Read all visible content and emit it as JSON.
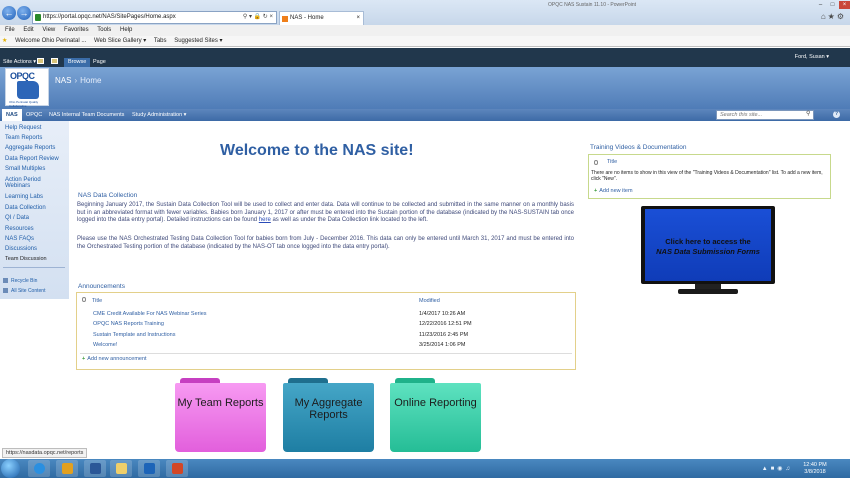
{
  "browser": {
    "url": "https://portal.opqc.net/NAS/SitePages/Home.aspx",
    "tab_title": "NAS - Home",
    "window_title": "OPQC NAS Sustain 11.10 - PowerPoint",
    "menu": [
      "File",
      "Edit",
      "View",
      "Favorites",
      "Tools",
      "Help"
    ],
    "favorites": [
      "Welcome  Ohio Perinatal ...",
      "Web Slice Gallery ▾",
      "Tabs",
      "Suggested Sites ▾"
    ],
    "status_url": "https://nasdata.opqc.net/reports"
  },
  "ribbon": {
    "site_actions": "Site Actions ▾",
    "tabs": [
      "Browse",
      "Page"
    ],
    "user": "Ford, Susan ▾"
  },
  "header": {
    "logo_text": "OPQC",
    "logo_tagline": "Ohio Perinatal Quality Collaborative",
    "site": "NAS",
    "separator": "›",
    "page": "Home"
  },
  "topnav": {
    "items": [
      "NAS",
      "OPQC",
      "NAS Internal Team Documents",
      "Study Administration ▾"
    ],
    "search_placeholder": "Search this site...",
    "help_label": "?"
  },
  "leftnav": {
    "items": [
      "Help Request",
      "Team Reports",
      "Aggregate Reports",
      "Data Report Review",
      "Small Multiples",
      "Action Period",
      "Webinars",
      "Learning Labs",
      "Data Collection",
      "QI / Data",
      "Resources",
      "NAS FAQs",
      "Discussions",
      "Team Discussion"
    ],
    "utility": [
      "Recycle Bin",
      "All Site Content"
    ]
  },
  "main": {
    "welcome": "Welcome to the NAS site!",
    "data_collection_title": "NAS Data Collection",
    "para1_a": "Beginning January 2017, the Sustain Data Collection Tool will be used to collect and enter data. Data will continue to be collected and submitted in the same manner on a monthly basis but in an abbreviated format with fewer variables. Babies born January 1, 2017 or after must be entered into the Sustain portion of the database (indicated by the NAS-SUSTAIN tab once logged into the data entry portal).  Detailed instructions can be found ",
    "para1_link": "here",
    "para1_b": " as well as under the Data Collection link located to the left.",
    "para2": "Please use the NAS Orchestrated Testing Data Collection Tool for babies born from July - December 2016. This data can only be entered until March 31, 2017 and must be entered into the Orchestrated Testing portion of the database (indicated by the NAS-OT tab once logged into the data entry portal)."
  },
  "announcements": {
    "title": "Announcements",
    "col_title": "Title",
    "col_modified": "Modified",
    "rows": [
      {
        "title": "CME Credit Available For NAS Webinar Series",
        "modified": "1/4/2017 10:26 AM"
      },
      {
        "title": "OPQC NAS Reports Training",
        "modified": "12/22/2016 12:51 PM"
      },
      {
        "title": "Sustain Template and Instructions",
        "modified": "11/23/2016 2:45 PM"
      },
      {
        "title": "Welcome!",
        "modified": "3/25/2014 1:06 PM"
      }
    ],
    "add_label": "Add new announcement"
  },
  "folders": [
    {
      "label": "My Team Reports",
      "color": "#f07be9"
    },
    {
      "label": "My Aggregate Reports",
      "color": "#2f92b9"
    },
    {
      "label": "Online Reporting",
      "color": "#3fd2ab"
    }
  ],
  "training": {
    "title": "Training Videos & Documentation",
    "col_title": "Title",
    "empty_msg": "There are no items to show in this view of the \"Training Videos & Documentation\" list. To add a new item, click \"New\".",
    "add_label": "Add new item"
  },
  "monitor": {
    "line1": "Click here to access the",
    "line2": "NAS Data Submission Forms"
  },
  "taskbar": {
    "time": "12:40 PM",
    "date": "3/8/2018"
  }
}
